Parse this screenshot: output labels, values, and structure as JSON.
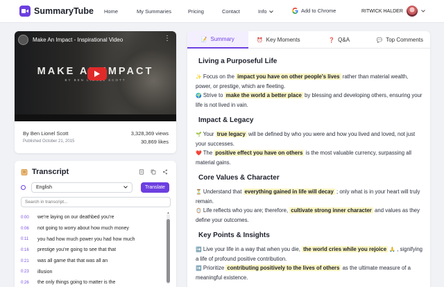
{
  "nav": {
    "brand": "SummaryTube",
    "links": [
      "Home",
      "My Summaries",
      "Pricing",
      "Contact"
    ],
    "info_label": "Info",
    "chrome_label": "Add to Chrome",
    "user_name": "RITWICK HALDER"
  },
  "video": {
    "title": "Make An Impact - Inspirational Video",
    "overlay_title": "MAKE AN IMPACT",
    "overlay_sub": "BY BEN LIONEL SCOTT",
    "author": "By Ben Lionel Scott",
    "published": "Published October 21, 2015",
    "views": "3,328,369 views",
    "likes": "30,869 likes"
  },
  "transcript": {
    "title": "Transcript",
    "language": "English",
    "translate_label": "Translate",
    "search_placeholder": "Search in transcript...",
    "lines": [
      {
        "t": "0:00",
        "text": "we're laying on our deathbed you're"
      },
      {
        "t": "0:06",
        "text": "not going to worry about how much money"
      },
      {
        "t": "0:11",
        "text": "you had how much power you had how much"
      },
      {
        "t": "0:16",
        "text": "prestige you're going to see that that"
      },
      {
        "t": "0:21",
        "text": "was all game that that was all an"
      },
      {
        "t": "0:23",
        "text": "illusion"
      },
      {
        "t": "0:26",
        "text": "the only things going to matter is the"
      }
    ]
  },
  "tabs": [
    {
      "icon": "📝",
      "label": "Summary"
    },
    {
      "icon": "⏰",
      "label": "Key Moments"
    },
    {
      "icon": "❓",
      "label": "Q&A"
    },
    {
      "icon": "💬",
      "label": "Top Comments"
    }
  ],
  "summary": {
    "s1_title": "Living a Purposeful Life",
    "s1_p1_a": "Focus on the",
    "s1_p1_hl": "impact you have on other people's lives",
    "s1_p1_b": "rather than material wealth, power, or prestige, which are fleeting.",
    "s1_p2_a": "Strive to",
    "s1_p2_hl": "make the world a better place",
    "s1_p2_b": "by blessing and developing others, ensuring your life is not lived in vain.",
    "s2_title": "Impact & Legacy",
    "s2_p1_a": "Your",
    "s2_p1_hl": "true legacy",
    "s2_p1_b": "will be defined by who you were and how you lived and loved, not just your successes.",
    "s2_p2_a": "The",
    "s2_p2_hl": "positive effect you have on others",
    "s2_p2_b": "is the most valuable currency, surpassing all material gains.",
    "s3_title": "Core Values & Character",
    "s3_p1_a": "Understand that",
    "s3_p1_hl": "everything gained in life will decay",
    "s3_p1_b": "; only what is in your heart will truly remain.",
    "s3_p2_a": "Life reflects who you are; therefore,",
    "s3_p2_hl": "cultivate strong inner character",
    "s3_p2_b": "and values as they define your outcomes.",
    "s4_title": "Key Points & Insights",
    "s4_p1_a": "Live your life in a way that when you die,",
    "s4_p1_hl": "the world cries while you rejoice",
    "s4_p1_b": ", signifying a life of profound positive contribution.",
    "s4_p2_a": "Prioritize",
    "s4_p2_hl": "contributing positively to the lives of others",
    "s4_p2_b": "as the ultimate measure of a meaningful existence."
  }
}
